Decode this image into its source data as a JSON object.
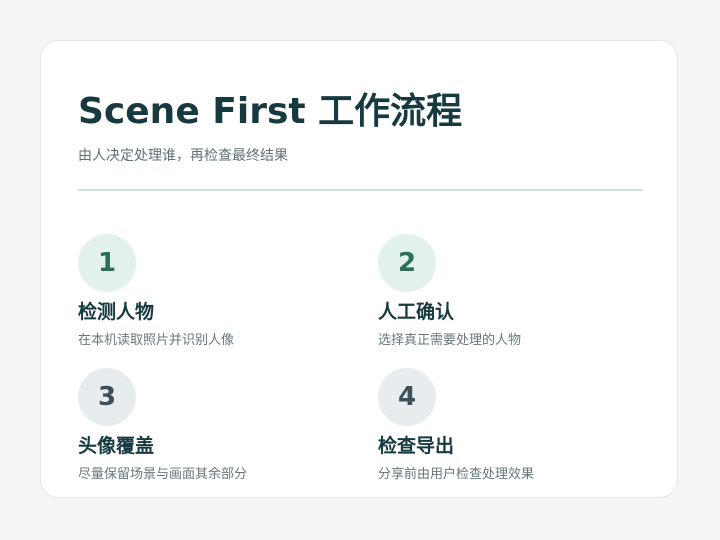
{
  "header": {
    "title": "Scene First 工作流程",
    "subtitle": "由人决定处理谁，再检查最终结果"
  },
  "steps": [
    {
      "number": "1",
      "title": "检测人物",
      "description": "在本机读取照片并识别人像"
    },
    {
      "number": "2",
      "title": "人工确认",
      "description": "选择真正需要处理的人物"
    },
    {
      "number": "3",
      "title": "头像覆盖",
      "description": "尽量保留场景与画面其余部分"
    },
    {
      "number": "4",
      "title": "检查导出",
      "description": "分享前由用户检查处理效果"
    }
  ],
  "colors": {
    "page_background": "#f3f5f7",
    "card_background": "#ffffff",
    "title": "#163a3f",
    "circle_green_background": "#e2f2ea",
    "circle_green_text": "#2f6e56",
    "circle_gray_background": "#e7ecef",
    "circle_gray_text": "#3b5058"
  }
}
